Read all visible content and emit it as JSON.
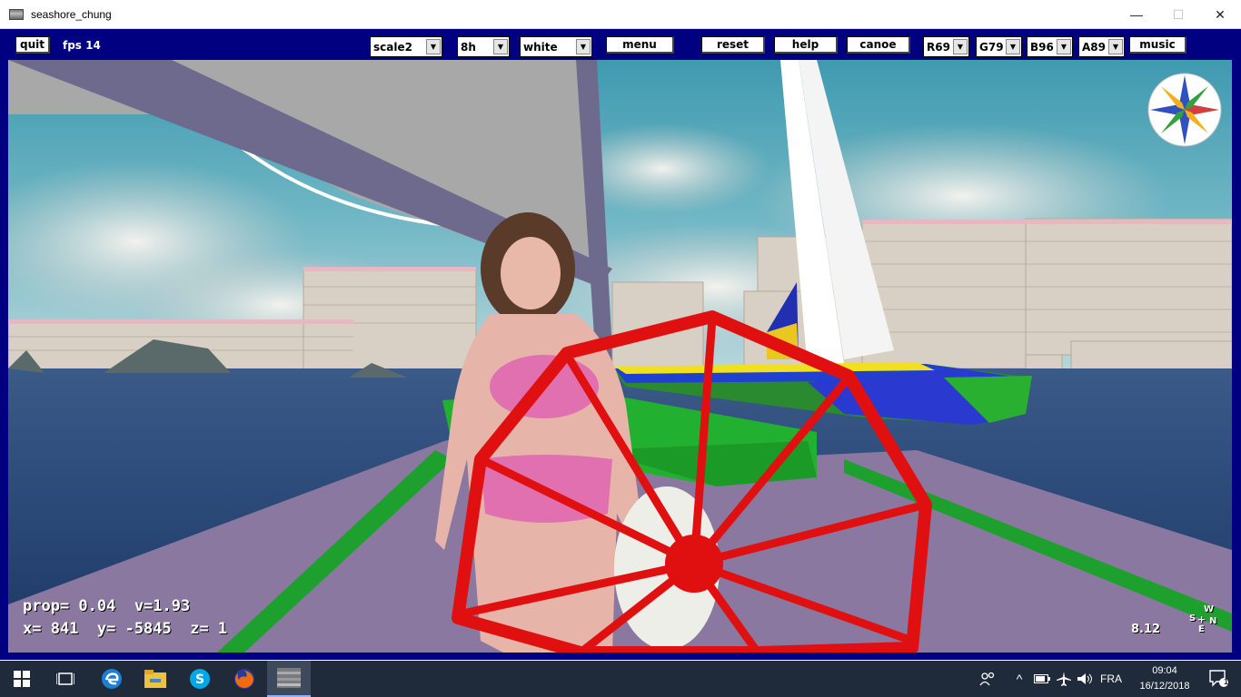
{
  "window": {
    "title": "seashore_chung",
    "minimize": "—",
    "maximize": "☐",
    "close": "✕"
  },
  "toolbar": {
    "quit": "quit",
    "fps": "fps 14",
    "scale": "scale2",
    "time": "8h",
    "color": "white",
    "menu": "menu",
    "reset": "reset",
    "help": "help",
    "canoe": "canoe",
    "r": "R69",
    "g": "G79",
    "b": "B96",
    "a": "A89",
    "music": "music"
  },
  "hud": {
    "line1": "prop= 0.04  v=1.93",
    "line2": "x= 841  y= -5845  z= 1",
    "zoom": "8.12",
    "compass_n": "N",
    "compass_s": "S",
    "compass_w": "W",
    "compass_e": "E"
  },
  "taskbar": {
    "language": "FRA",
    "time": "09:04",
    "date": "16/12/2018",
    "notifications": "1",
    "apps": [
      "windows-start-icon",
      "task-view-icon",
      "edge-icon",
      "file-explorer-icon",
      "skype-icon",
      "firefox-icon",
      "seashore-app-icon"
    ]
  },
  "colors": {
    "frame": "#000080",
    "deck": "#8a78a0",
    "wheel": "#e01010",
    "hull_green": "#22b030",
    "sea": "#2a4a78",
    "taskbar": "#1f2b3a"
  }
}
